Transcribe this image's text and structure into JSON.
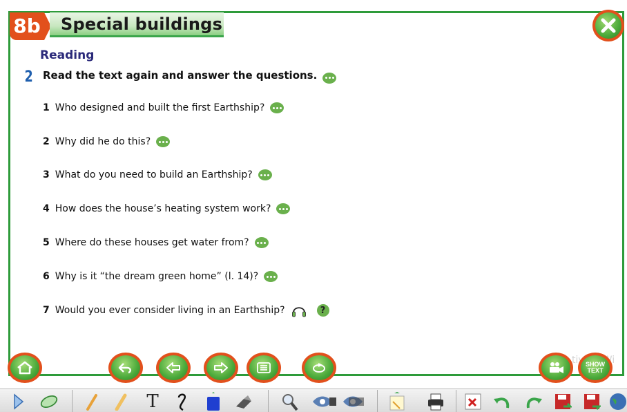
{
  "header": {
    "unit": "8b",
    "title": "Special buildings"
  },
  "section": {
    "label": "Reading",
    "exercise_number": "2",
    "instruction": "Read the text again and answer the questions."
  },
  "questions": [
    {
      "num": "1",
      "text": "Who designed and built the first Earthship?"
    },
    {
      "num": "2",
      "text": "Why did he do this?"
    },
    {
      "num": "3",
      "text": "What do you need to build an Earthship?"
    },
    {
      "num": "4",
      "text": "How does the house’s heating system work?"
    },
    {
      "num": "5",
      "text": "Where do these houses get water from?"
    },
    {
      "num": "6",
      "text": "Why is it “the dream green home” (l. 14)?"
    },
    {
      "num": "7",
      "text": "Would you ever consider living in an Earthship?"
    }
  ],
  "help_label": "?",
  "nav": {
    "show_text": "SHOW TEXT",
    "watermark": "tivate Wi"
  },
  "toolbar_text_tool": "T",
  "icons": [
    "home-icon",
    "undo-arrow-icon",
    "left-arrow-icon",
    "right-arrow-icon",
    "list-icon",
    "refresh-icon",
    "video-camera-icon",
    "close-icon",
    "headphones-icon",
    "speech-bubble-icon"
  ],
  "colors": {
    "accent_green": "#2e9b3a",
    "badge_orange": "#e2501c",
    "title_blue": "#2b2a7a",
    "exercise_blue": "#1f5fae"
  }
}
